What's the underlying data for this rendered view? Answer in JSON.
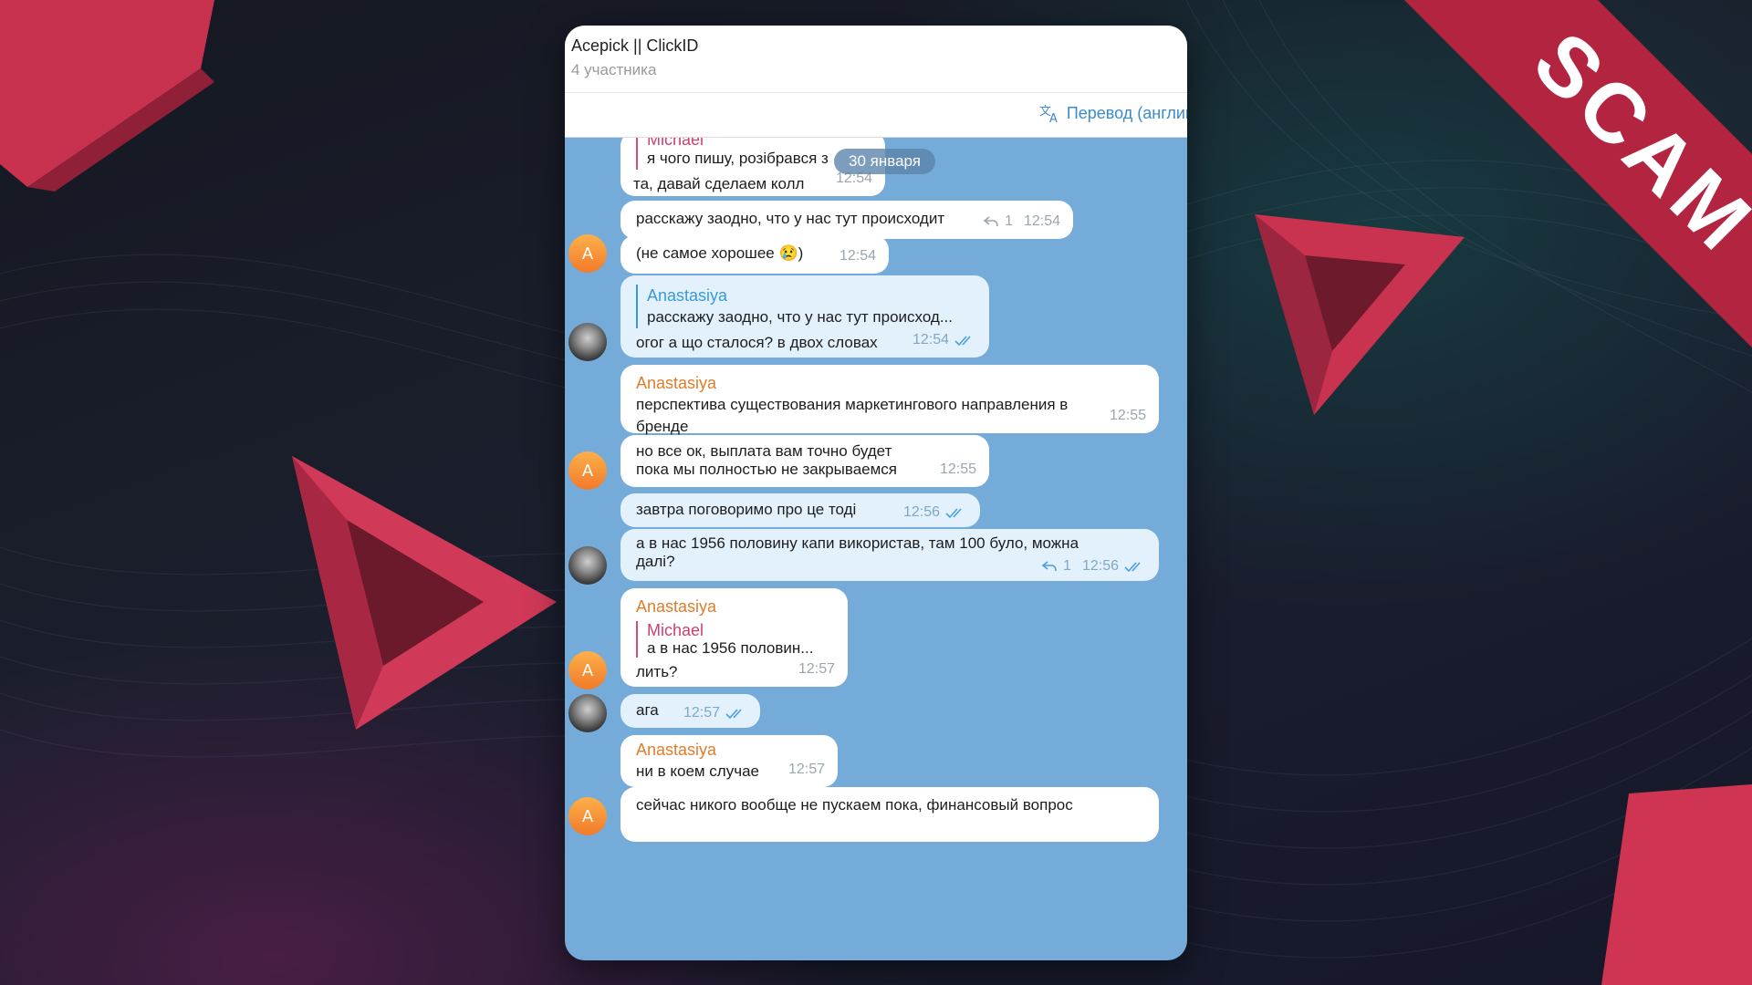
{
  "chat": {
    "title": "Acepick || ClickID",
    "subtitle": "4 участника",
    "translate_label": "Перевод (англий",
    "date_pill": "30 января"
  },
  "badge": {
    "text": "SCAM"
  },
  "colors": {
    "ribbon": "#b2243f",
    "chat_bg": "#74abd9",
    "outgoing_bubble": "#e3f1fc",
    "sender_orange": "#e07c2a",
    "reply_pink": "#cf3f6f",
    "reply_blue": "#3a9ad6"
  },
  "icons": {
    "translate": "translate-icon",
    "read": "double-check-icon",
    "replies": "reply-arrow-icon"
  },
  "messages": [
    {
      "reply_name": "Michael",
      "line1": "я чого пишу, розібрався з",
      "line2": "та, давай сделаем колл",
      "time": "12:54"
    },
    {
      "text": "расскажу заодно, что у нас тут происходит",
      "reply_count": "1",
      "time": "12:54"
    },
    {
      "text": "(не самое хорошее 😢)",
      "time": "12:54",
      "avatar": "A"
    },
    {
      "reply_name": "Anastasiya",
      "reply_text": "расскажу заодно, что у нас тут происход...",
      "text": "огог а що сталося? в двох словах",
      "time": "12:54"
    },
    {
      "sender": "Anastasiya",
      "line1": "перспектива существования маркетингового направления в",
      "line2": "бренде",
      "time": "12:55"
    },
    {
      "line1": "но все ок, выплата вам точно будет",
      "line2": "пока мы полностью не закрываемся",
      "time": "12:55",
      "avatar": "A"
    },
    {
      "text": "завтра поговоримо про це тоді",
      "time": "12:56"
    },
    {
      "line1": "а в нас 1956 половину капи використав, там 100 було, можна",
      "line2": "далі?",
      "reply_count": "1",
      "time": "12:56"
    },
    {
      "sender": "Anastasiya",
      "reply_name": "Michael",
      "reply_text": "а в нас 1956 половин...",
      "text": "лить?",
      "time": "12:57",
      "avatar": "A"
    },
    {
      "text": "ага",
      "time": "12:57"
    },
    {
      "sender": "Anastasiya",
      "text": "ни в коем случае",
      "time": "12:57",
      "avatar": "A"
    },
    {
      "text": "сейчас никого вообще не пускаем пока, финансовый вопрос"
    }
  ]
}
